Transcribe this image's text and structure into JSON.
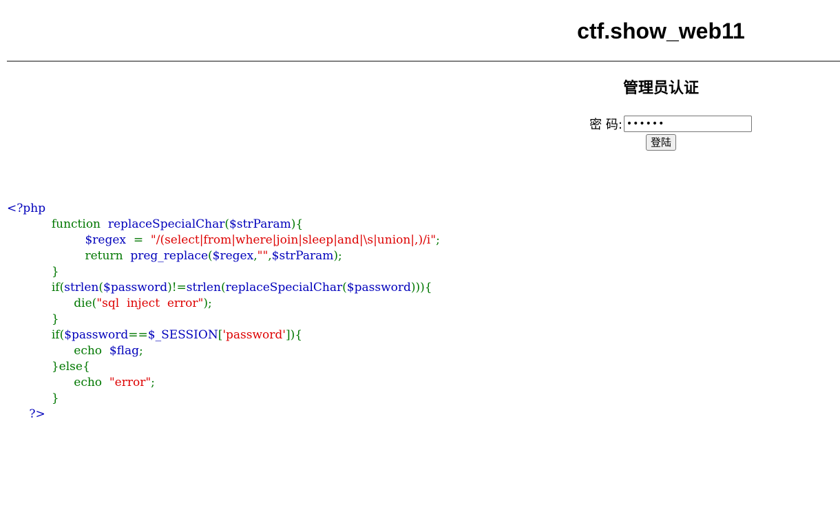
{
  "header": {
    "title": "ctf.show_web11"
  },
  "login": {
    "heading": "管理员认证",
    "password_label": "密  码:",
    "password_value": "••••••",
    "submit_label": "登陆"
  },
  "code": {
    "lines": [
      [
        {
          "t": "tag",
          "v": "<?php"
        }
      ],
      [
        {
          "t": "kw",
          "v": "            function  "
        },
        {
          "t": "var",
          "v": "replaceSpecialChar"
        },
        {
          "t": "op",
          "v": "("
        },
        {
          "t": "var",
          "v": "$strParam"
        },
        {
          "t": "op",
          "v": "){"
        }
      ],
      [
        {
          "t": "op",
          "v": "                     "
        },
        {
          "t": "var",
          "v": "$regex  "
        },
        {
          "t": "op",
          "v": "=  "
        },
        {
          "t": "str",
          "v": "\"/(select|from|where|join|sleep|and|\\s|union|,)/i\""
        },
        {
          "t": "op",
          "v": ";"
        }
      ],
      [
        {
          "t": "kw",
          "v": "                     return  "
        },
        {
          "t": "var",
          "v": "preg_replace"
        },
        {
          "t": "op",
          "v": "("
        },
        {
          "t": "var",
          "v": "$regex"
        },
        {
          "t": "op",
          "v": ","
        },
        {
          "t": "str",
          "v": "\"\""
        },
        {
          "t": "op",
          "v": ","
        },
        {
          "t": "var",
          "v": "$strParam"
        },
        {
          "t": "op",
          "v": ");"
        }
      ],
      [
        {
          "t": "op",
          "v": "            }"
        }
      ],
      [
        {
          "t": "kw",
          "v": "            if"
        },
        {
          "t": "op",
          "v": "("
        },
        {
          "t": "var",
          "v": "strlen"
        },
        {
          "t": "op",
          "v": "("
        },
        {
          "t": "var",
          "v": "$password"
        },
        {
          "t": "op",
          "v": ")!="
        },
        {
          "t": "var",
          "v": "strlen"
        },
        {
          "t": "op",
          "v": "("
        },
        {
          "t": "var",
          "v": "replaceSpecialChar"
        },
        {
          "t": "op",
          "v": "("
        },
        {
          "t": "var",
          "v": "$password"
        },
        {
          "t": "op",
          "v": "))){"
        }
      ],
      [
        {
          "t": "kw",
          "v": "                  die"
        },
        {
          "t": "op",
          "v": "("
        },
        {
          "t": "str",
          "v": "\"sql  inject  error\""
        },
        {
          "t": "op",
          "v": ");"
        }
      ],
      [
        {
          "t": "op",
          "v": "            }"
        }
      ],
      [
        {
          "t": "kw",
          "v": "            if"
        },
        {
          "t": "op",
          "v": "("
        },
        {
          "t": "var",
          "v": "$password"
        },
        {
          "t": "op",
          "v": "=="
        },
        {
          "t": "var",
          "v": "$_SESSION"
        },
        {
          "t": "op",
          "v": "["
        },
        {
          "t": "str",
          "v": "'password'"
        },
        {
          "t": "op",
          "v": "]){"
        }
      ],
      [
        {
          "t": "kw",
          "v": "                  echo  "
        },
        {
          "t": "var",
          "v": "$flag"
        },
        {
          "t": "op",
          "v": ";"
        }
      ],
      [
        {
          "t": "op",
          "v": "            }"
        },
        {
          "t": "kw",
          "v": "else"
        },
        {
          "t": "op",
          "v": "{"
        }
      ],
      [
        {
          "t": "kw",
          "v": "                  echo  "
        },
        {
          "t": "str",
          "v": "\"error\""
        },
        {
          "t": "op",
          "v": ";"
        }
      ],
      [
        {
          "t": "op",
          "v": "            }"
        }
      ],
      [
        {
          "t": "tag",
          "v": "      ?>"
        }
      ]
    ]
  }
}
